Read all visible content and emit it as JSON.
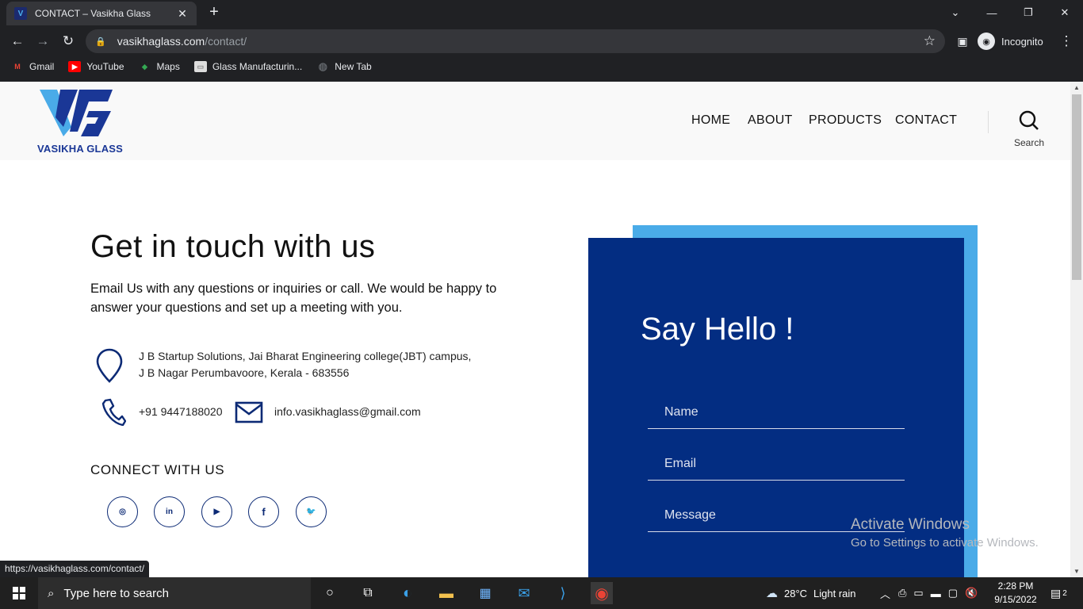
{
  "browser": {
    "tab_title": "CONTACT – Vasikha Glass",
    "url_host": "vasikhaglass.com",
    "url_path": "/contact/",
    "incognito_label": "Incognito",
    "bookmarks": [
      {
        "label": "Gmail",
        "icon": "gmail-icon",
        "color": "#ea4335"
      },
      {
        "label": "YouTube",
        "icon": "youtube-icon",
        "color": "#ff0000"
      },
      {
        "label": "Maps",
        "icon": "maps-icon",
        "color": "#34a853"
      },
      {
        "label": "Glass Manufacturin...",
        "icon": "page-icon",
        "color": "#dddddd"
      },
      {
        "label": "New Tab",
        "icon": "globe-icon",
        "color": "#5f6368"
      }
    ],
    "status_url": "https://vasikhaglass.com/contact/"
  },
  "site": {
    "logo_text": "VASIKHA GLASS",
    "nav": [
      "HOME",
      "ABOUT",
      "PRODUCTS",
      "CONTACT"
    ],
    "search_label": "Search",
    "heading": "Get in touch with us",
    "intro": "Email Us with any questions or inquiries or call. We would be happy to answer your questions and set up a meeting with you.",
    "address_line1": "J B  Startup Solutions, Jai Bharat Engineering college(JBT)  campus,",
    "address_line2": "J B Nagar Perumbavoore, Kerala - 683556",
    "phone": "+91 9447188020",
    "email": "info.vasikhaglass@gmail.com",
    "connect_heading": "CONNECT WITH US",
    "social": [
      "instagram-icon",
      "linkedin-icon",
      "youtube-icon",
      "facebook-icon",
      "twitter-icon"
    ],
    "form_title": "Say Hello !",
    "form_fields": {
      "name": "Name",
      "email": "Email",
      "message": "Message"
    },
    "colors": {
      "brand_dark": "#032d82",
      "brand_light": "#4aabe8"
    }
  },
  "watermark": {
    "line1": "Activate Windows",
    "line2": "Go to Settings to activate Windows."
  },
  "taskbar": {
    "search_placeholder": "Type here to search",
    "weather_temp": "28°C",
    "weather_desc": "Light rain",
    "time": "2:28 PM",
    "date": "9/15/2022",
    "notif_count": "2"
  }
}
